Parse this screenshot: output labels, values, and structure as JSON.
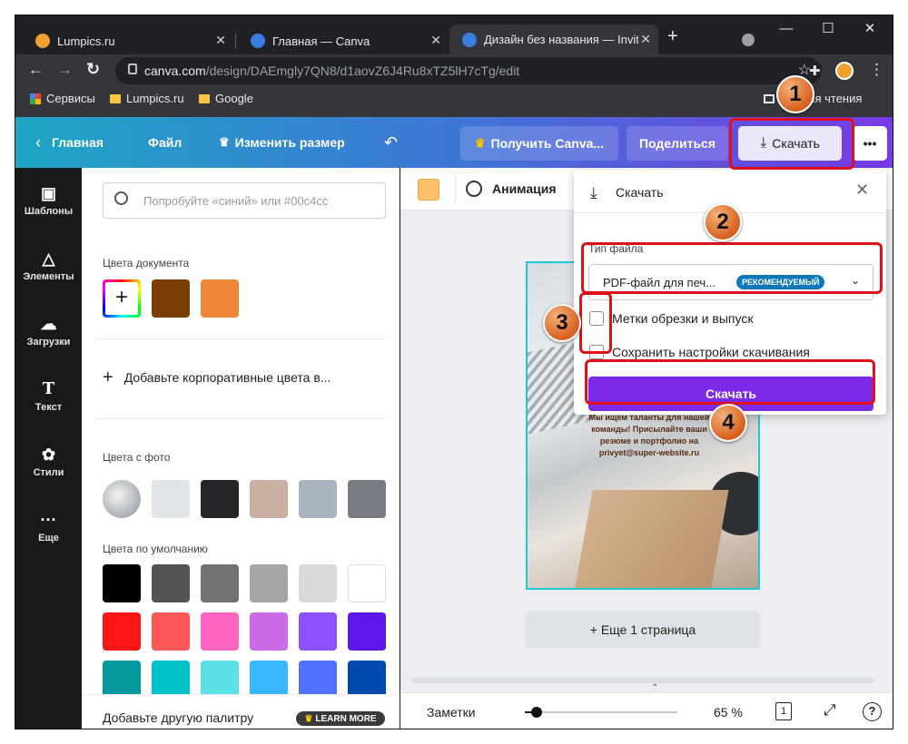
{
  "browser": {
    "tabs": [
      {
        "title": "Lumpics.ru",
        "close": "✕"
      },
      {
        "title": "Главная — Canva",
        "close": "✕"
      },
      {
        "title": "Дизайн без названия — Invitat",
        "close": "✕"
      }
    ],
    "new_tab": "+",
    "url_host": "canva.com",
    "url_path": "/design/DAEmgly7QN8/d1aovZ6J4Ru8xTZ5lH7cTg/edit",
    "bookmarks": [
      "Сервисы",
      "Lumpics.ru",
      "Google"
    ],
    "reading_list": "к для чтения"
  },
  "topbar": {
    "home": "Главная",
    "file": "Файл",
    "resize": "Изменить размер",
    "get_pro": "Получить Canva...",
    "share": "Поделиться",
    "download": "Скачать",
    "more": "•••"
  },
  "rail": [
    {
      "label": "Шаблоны",
      "icon": "layout-icon"
    },
    {
      "label": "Элементы",
      "icon": "shapes-icon"
    },
    {
      "label": "Загрузки",
      "icon": "cloud-upload-icon"
    },
    {
      "label": "Текст",
      "icon": "text-icon"
    },
    {
      "label": "Стили",
      "icon": "palette-icon"
    },
    {
      "label": "Еще",
      "icon": "more-icon"
    }
  ],
  "panel": {
    "search_placeholder": "Попробуйте «синий» или #00c4cc",
    "doc_colors_title": "Цвета документа",
    "doc_colors": [
      "#7a3e05",
      "#f0883a"
    ],
    "add_brand": "Добавьте корпоративные цвета в...",
    "photo_colors_title": "Цвета с фото",
    "photo_colors": [
      "#e2e5e8",
      "#25252c",
      "#c9b0a0",
      "#a8b3be",
      "#787b82"
    ],
    "default_colors_title": "Цвета по умолчанию",
    "default_colors": [
      "#000000",
      "#545454",
      "#737373",
      "#a6a6a6",
      "#d9d9d9",
      "#ffffff",
      "#ff1616",
      "#ff5757",
      "#ff66c4",
      "#cb6ce6",
      "#8c52ff",
      "#5e17eb",
      "#03989e",
      "#00c2cb",
      "#5ce1e6",
      "#38b6ff",
      "#5271ff",
      "#004aad"
    ],
    "add_palette": "Добавьте другую палитру",
    "learn_more": "LEARN MORE"
  },
  "toolbar": {
    "animation": "Анимация"
  },
  "design": {
    "text": "Мы ищем таланты для нашей команды! Присылайте ваши резюме и портфолио на privyet@super-website.ru",
    "add_page": "+ Еще 1 страница"
  },
  "bottombar": {
    "notes": "Заметки",
    "zoom": "65 %",
    "zoom_value": 0.08,
    "page_count": "1",
    "help": "?"
  },
  "dialog": {
    "title": "Скачать",
    "file_type_label": "Тип файла",
    "file_type_value": "PDF-файл для печ...",
    "recommended": "РЕКОМЕНДУЕМЫЙ",
    "crop_marks": "Метки обрезки и выпуск",
    "save_settings": "Сохранить настройки скачивания",
    "download_button": "Скачать"
  },
  "steps": [
    "1",
    "2",
    "3",
    "4"
  ],
  "colors": {
    "accent": "#7d2ae8",
    "highlight": "#e0101a"
  }
}
